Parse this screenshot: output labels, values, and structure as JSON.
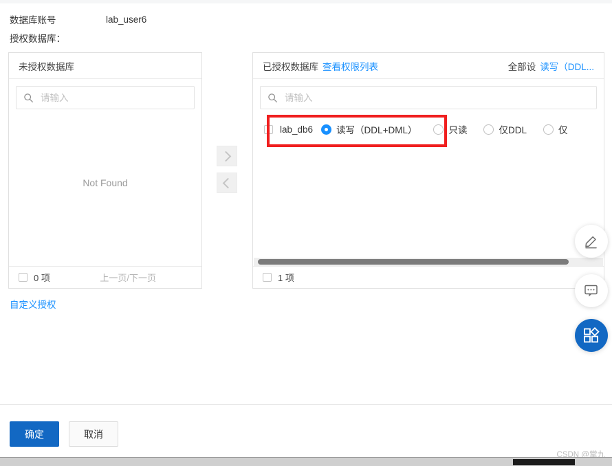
{
  "form": {
    "account_label": "数据库账号",
    "account_value": "lab_user6",
    "auth_db_label": "授权数据库："
  },
  "left_panel": {
    "title": "未授权数据库",
    "search_placeholder": "请输入",
    "search_value": "",
    "empty_text": "Not Found",
    "count_text": "0 项",
    "pager_text": "上一页/下一页"
  },
  "right_panel": {
    "title": "已授权数据库",
    "view_perm_link": "查看权限列表",
    "set_all_label": "全部设",
    "set_all_value": "读写（DDL...",
    "search_placeholder": "请输入",
    "search_value": "",
    "count_text": "1 项",
    "row": {
      "db_name": "lab_db6",
      "checked": false,
      "options": [
        {
          "label": "读写（DDL+DML）",
          "selected": true
        },
        {
          "label": "只读",
          "selected": false
        },
        {
          "label": "仅DDL",
          "selected": false
        },
        {
          "label": "仅",
          "selected": false
        }
      ]
    }
  },
  "transfer_buttons": {
    "to_right": "chevron-right-icon",
    "to_left": "chevron-left-icon"
  },
  "custom_auth_link": "自定义授权",
  "floating_buttons": [
    {
      "name": "edit-icon"
    },
    {
      "name": "feedback-icon"
    },
    {
      "name": "apps-icon"
    }
  ],
  "footer": {
    "confirm_label": "确定",
    "cancel_label": "取消"
  },
  "watermark": "CSDN @掌九",
  "colors": {
    "primary": "#1268c3",
    "link": "#1890ff",
    "annotation": "#f01f1f"
  }
}
